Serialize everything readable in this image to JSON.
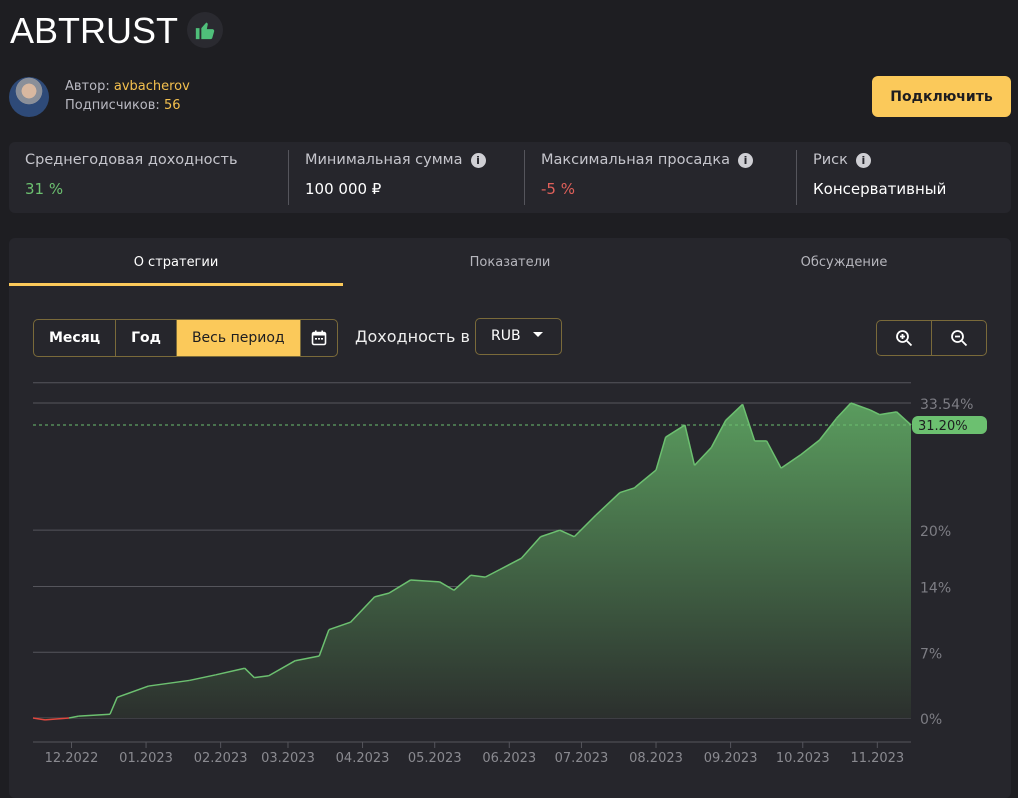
{
  "header": {
    "title": "ABTRUST",
    "like_icon": "thumbs-up-icon",
    "like_color": "#4fbf7a",
    "author_label": "Автор:",
    "author": "avbacherov",
    "subs_label": "Подписчиков:",
    "subs": "56",
    "connect": "Подключить"
  },
  "stats": [
    {
      "label": "Среднегодовая доходность",
      "value": "31 %",
      "color": "#6cc070",
      "info": false
    },
    {
      "label": "Минимальная сумма",
      "value": "100 000 ₽",
      "color": "#ffffff",
      "info": true
    },
    {
      "label": "Максимальная просадка",
      "value": "-5 %",
      "color": "#e0605a",
      "info": true
    },
    {
      "label": "Риск",
      "value": "Консервативный",
      "color": "#ffffff",
      "info": true
    }
  ],
  "tabs": [
    "О стратегии",
    "Показатели",
    "Обсуждение"
  ],
  "controls": {
    "periods": [
      "Месяц",
      "Год",
      "Весь период"
    ],
    "active_period": "Весь период",
    "yield_label": "Доходность в",
    "currency": "RUB"
  },
  "chart_data": {
    "type": "area",
    "x_tick_labels": [
      "12.2022",
      "01.2023",
      "02.2023",
      "03.2023",
      "04.2023",
      "05.2023",
      "06.2023",
      "07.2023",
      "08.2023",
      "09.2023",
      "10.2023",
      "11.2023"
    ],
    "y_tick_labels": [
      "0%",
      "7%",
      "14%",
      "20%",
      "33.54%"
    ],
    "y_ticks": [
      0,
      7,
      14,
      20,
      33.54
    ],
    "ylim": [
      -3,
      35.7
    ],
    "current_value_label": "31.20%",
    "current_value": 31.2,
    "max_label_value": 33.54,
    "grid": true,
    "line_color": "#6cc070",
    "negative_color": "#e0483f",
    "points": [
      [
        "2022-11-15",
        0
      ],
      [
        "2022-11-20",
        -0.2
      ],
      [
        "2022-11-30",
        0
      ],
      [
        "2022-12-04",
        0.2
      ],
      [
        "2022-12-17",
        0.4
      ],
      [
        "2022-12-20",
        2.2
      ],
      [
        "2023-01-02",
        3.4
      ],
      [
        "2023-01-19",
        4.0
      ],
      [
        "2023-01-30",
        4.6
      ],
      [
        "2023-02-11",
        5.3
      ],
      [
        "2023-02-15",
        4.3
      ],
      [
        "2023-02-21",
        4.5
      ],
      [
        "2023-03-04",
        6.1
      ],
      [
        "2023-03-14",
        6.6
      ],
      [
        "2023-03-18",
        9.4
      ],
      [
        "2023-03-27",
        10.2
      ],
      [
        "2023-04-06",
        12.9
      ],
      [
        "2023-04-12",
        13.3
      ],
      [
        "2023-04-21",
        14.7
      ],
      [
        "2023-05-03",
        14.5
      ],
      [
        "2023-05-09",
        13.6
      ],
      [
        "2023-05-16",
        15.2
      ],
      [
        "2023-05-22",
        15.0
      ],
      [
        "2023-05-28",
        15.8
      ],
      [
        "2023-06-06",
        17.0
      ],
      [
        "2023-06-14",
        19.3
      ],
      [
        "2023-06-22",
        20.0
      ],
      [
        "2023-06-28",
        19.3
      ],
      [
        "2023-07-07",
        21.6
      ],
      [
        "2023-07-17",
        24.0
      ],
      [
        "2023-07-23",
        24.5
      ],
      [
        "2023-08-01",
        26.4
      ],
      [
        "2023-08-05",
        29.9
      ],
      [
        "2023-08-13",
        31.2
      ],
      [
        "2023-08-17",
        26.9
      ],
      [
        "2023-08-24",
        28.8
      ],
      [
        "2023-08-30",
        31.7
      ],
      [
        "2023-09-06",
        33.4
      ],
      [
        "2023-09-11",
        29.5
      ],
      [
        "2023-09-16",
        29.5
      ],
      [
        "2023-09-22",
        26.6
      ],
      [
        "2023-09-30",
        28.0
      ],
      [
        "2023-10-08",
        29.6
      ],
      [
        "2023-10-15",
        31.9
      ],
      [
        "2023-10-21",
        33.54
      ],
      [
        "2023-10-29",
        32.8
      ],
      [
        "2023-11-02",
        32.3
      ],
      [
        "2023-11-09",
        32.6
      ],
      [
        "2023-11-15",
        31.2
      ]
    ]
  }
}
